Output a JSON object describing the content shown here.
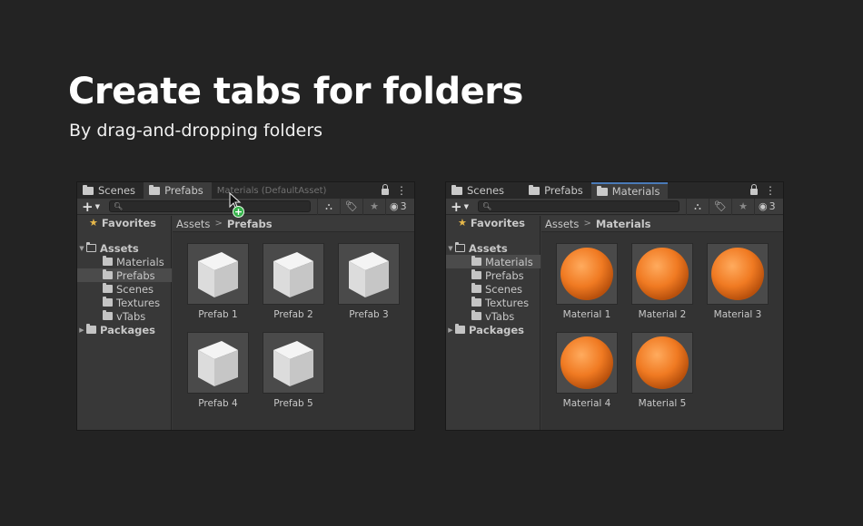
{
  "hero": {
    "title": "Create tabs for folders",
    "subtitle": "By drag-and-dropping folders"
  },
  "colors": {
    "background": "#232323",
    "panel": "#383838",
    "accent_tab": "#4a7ab8",
    "material_orange": "#f07a22",
    "favorites_star": "#e7b84a",
    "add_badge": "#35b24a"
  },
  "left_panel": {
    "tabs": [
      {
        "label": "Scenes",
        "icon": "folder-icon",
        "active": false
      },
      {
        "label": "Prefabs",
        "icon": "folder-icon",
        "active": true
      },
      {
        "label": "Materials (DefaultAsset)",
        "icon": "",
        "active": false
      }
    ],
    "hidden_count": "3",
    "tree": {
      "favorites": "Favorites",
      "assets": "Assets",
      "children": [
        "Materials",
        "Prefabs",
        "Scenes",
        "Textures",
        "vTabs"
      ],
      "selected_index": 1,
      "packages": "Packages"
    },
    "breadcrumb": {
      "root": "Assets",
      "current": "Prefabs"
    },
    "items": [
      "Prefab 1",
      "Prefab 2",
      "Prefab 3",
      "Prefab 4",
      "Prefab 5"
    ]
  },
  "right_panel": {
    "tabs": [
      {
        "label": "Scenes",
        "icon": "folder-icon",
        "active": false
      },
      {
        "label": "Prefabs",
        "icon": "folder-icon",
        "active": false
      },
      {
        "label": "Materials",
        "icon": "folder-icon",
        "active": true
      }
    ],
    "hidden_count": "3",
    "tree": {
      "favorites": "Favorites",
      "assets": "Assets",
      "children": [
        "Materials",
        "Prefabs",
        "Scenes",
        "Textures",
        "vTabs"
      ],
      "selected_index": 0,
      "packages": "Packages"
    },
    "breadcrumb": {
      "root": "Assets",
      "current": "Materials"
    },
    "items": [
      "Material 1",
      "Material 2",
      "Material 3",
      "Material 4",
      "Material 5"
    ]
  },
  "drag": {
    "badge": "+"
  }
}
